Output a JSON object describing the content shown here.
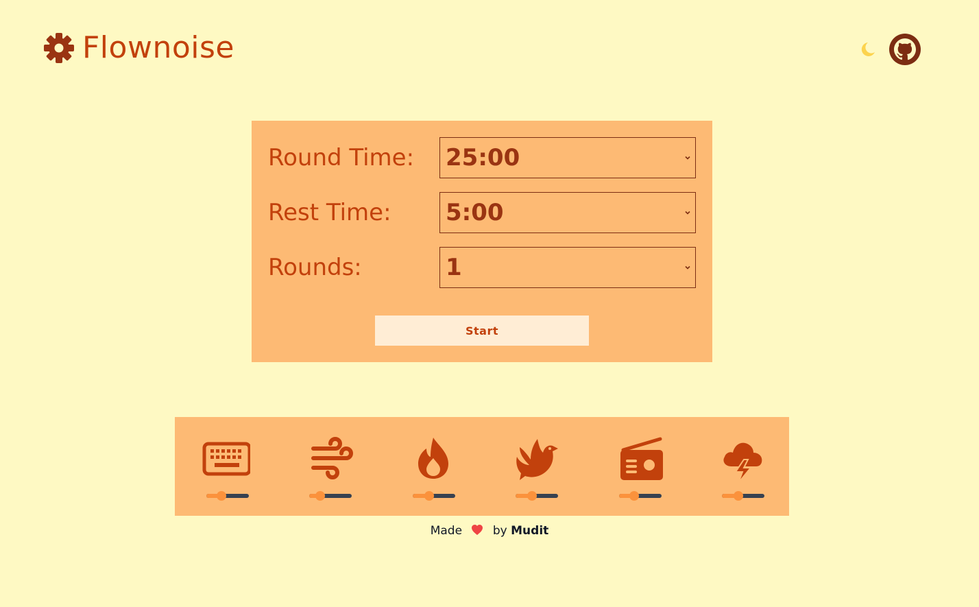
{
  "header": {
    "app_name": "Flownoise",
    "logo_icon": "gear-icon",
    "theme_toggle_icon": "moon-icon",
    "repo_icon": "github-icon"
  },
  "settings": {
    "round_time": {
      "label": "Round Time:",
      "value": "25:00"
    },
    "rest_time": {
      "label": "Rest Time:",
      "value": "5:00"
    },
    "rounds": {
      "label": "Rounds:",
      "value": "1"
    },
    "start_label": "Start"
  },
  "sounds": [
    {
      "name": "keyboard",
      "icon": "keyboard-icon",
      "volume": 0.35
    },
    {
      "name": "wind",
      "icon": "wind-icon",
      "volume": 0.25
    },
    {
      "name": "fire",
      "icon": "fire-icon",
      "volume": 0.38
    },
    {
      "name": "birds",
      "icon": "bird-icon",
      "volume": 0.38
    },
    {
      "name": "radio",
      "icon": "radio-icon",
      "volume": 0.36
    },
    {
      "name": "storm",
      "icon": "storm-cloud-icon",
      "volume": 0.38
    }
  ],
  "footer": {
    "made_text": "Made",
    "by_text": "by",
    "author": "Mudit",
    "heart_icon": "heart-icon"
  },
  "colors": {
    "background": "#fef9c3",
    "card": "#fdba74",
    "accent": "#c2410c",
    "accent_dark": "#7c2d12",
    "slider_fill": "#fb923c",
    "slider_track": "#374151",
    "button_bg": "#ffedd5"
  }
}
